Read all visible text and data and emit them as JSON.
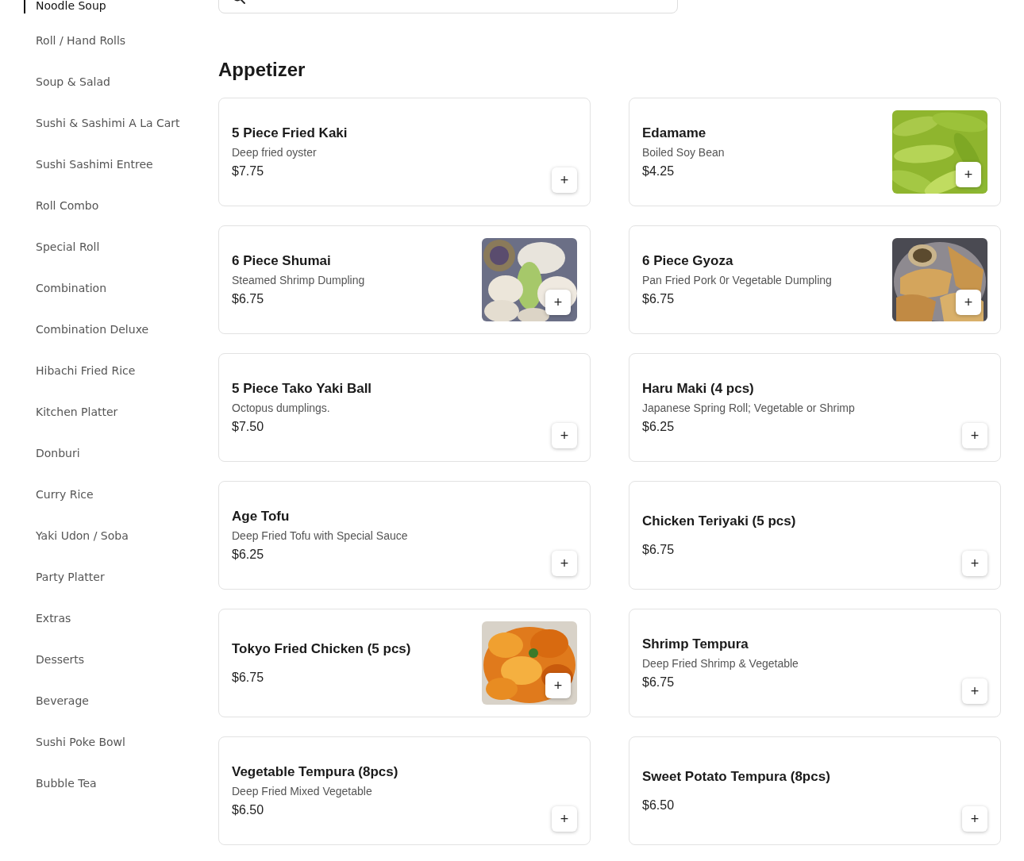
{
  "sidebar": {
    "items": [
      {
        "label": "Noodle Soup",
        "selected": true
      },
      {
        "label": "Roll / Hand Rolls",
        "selected": false
      },
      {
        "label": "Soup & Salad",
        "selected": false
      },
      {
        "label": "Sushi & Sashimi A La Cart",
        "selected": false
      },
      {
        "label": "Sushi Sashimi Entree",
        "selected": false
      },
      {
        "label": "Roll Combo",
        "selected": false
      },
      {
        "label": "Special Roll",
        "selected": false
      },
      {
        "label": "Combination",
        "selected": false
      },
      {
        "label": "Combination Deluxe",
        "selected": false
      },
      {
        "label": "Hibachi Fried Rice",
        "selected": false
      },
      {
        "label": "Kitchen Platter",
        "selected": false
      },
      {
        "label": "Donburi",
        "selected": false
      },
      {
        "label": "Curry Rice",
        "selected": false
      },
      {
        "label": "Yaki Udon / Soba",
        "selected": false
      },
      {
        "label": "Party Platter",
        "selected": false
      },
      {
        "label": "Extras",
        "selected": false
      },
      {
        "label": "Desserts",
        "selected": false
      },
      {
        "label": "Beverage",
        "selected": false
      },
      {
        "label": "Sushi Poke Bowl",
        "selected": false
      },
      {
        "label": "Bubble Tea",
        "selected": false
      }
    ]
  },
  "section": {
    "title": "Appetizer",
    "items": [
      {
        "name": "5 Piece Fried Kaki",
        "description": "Deep fried oyster",
        "price": "$7.75",
        "add": "+"
      },
      {
        "name": "Edamame",
        "description": "Boiled Soy Bean",
        "price": "$4.25",
        "add": "+",
        "kind": "picture"
      },
      {
        "name": "6 Piece Shumai",
        "description": "Steamed Shrimp Dumpling",
        "price": "$6.75",
        "add": "+",
        "kind": "picture"
      },
      {
        "name": "6 Piece Gyoza",
        "description": "Pan Fried Pork 0r Vegetable Dumpling",
        "price": "$6.75",
        "add": "+",
        "kind": "picture"
      },
      {
        "name": "5 Piece Tako Yaki Ball",
        "description": "Octopus dumplings.",
        "price": "$7.50",
        "add": "+"
      },
      {
        "name": "Haru Maki (4 pcs)",
        "description": "Japanese Spring Roll; Vegetable or Shrimp",
        "price": "$6.25",
        "add": "+"
      },
      {
        "name": "Age Tofu",
        "description": "Deep Fried Tofu with Special Sauce",
        "price": "$6.25",
        "add": "+"
      },
      {
        "name": "Chicken Teriyaki (5 pcs)",
        "price": "$6.75",
        "add": "+"
      },
      {
        "name": "Tokyo Fried Chicken (5 pcs)",
        "price": "$6.75",
        "add": "+",
        "kind": "picture"
      },
      {
        "name": "Shrimp Tempura",
        "description": "Deep Fried Shrimp & Vegetable",
        "price": "$6.75",
        "add": "+"
      },
      {
        "name": "Vegetable Tempura (8pcs)",
        "description": "Deep Fried Mixed Vegetable",
        "price": "$6.50",
        "add": "+"
      },
      {
        "name": "Sweet Potato Tempura (8pcs)",
        "price": "$6.50",
        "add": "+"
      }
    ]
  }
}
